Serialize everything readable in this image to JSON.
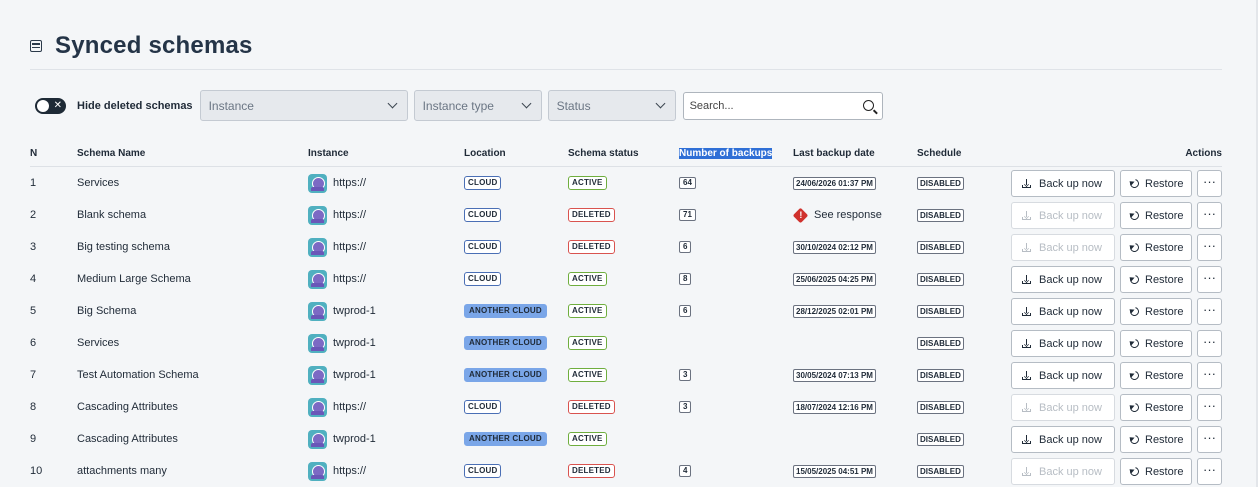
{
  "page": {
    "title": "Synced schemas",
    "icon": "list-icon"
  },
  "filters": {
    "toggle_label": "Hide deleted schemas",
    "toggle_on": true,
    "instance_placeholder": "Instance",
    "instance_type_placeholder": "Instance type",
    "status_placeholder": "Status",
    "search_placeholder": "Search..."
  },
  "columns": {
    "n": "N",
    "schema_name": "Schema Name",
    "instance": "Instance",
    "location": "Location",
    "schema_status": "Schema status",
    "backups": "Number of backups",
    "last_backup": "Last backup date",
    "schedule": "Schedule",
    "actions": "Actions"
  },
  "actions": {
    "backup_label": "Back up now",
    "restore_label": "Restore",
    "more_label": "···"
  },
  "rows": [
    {
      "n": "1",
      "name": "Services",
      "instance": "https://",
      "location": "CLOUD",
      "status": "ACTIVE",
      "backups": "64",
      "last_backup": "24/06/2026 01:37 PM",
      "schedule": "DISABLED",
      "backup_enabled": true
    },
    {
      "n": "2",
      "name": "Blank schema",
      "instance": "https://",
      "location": "CLOUD",
      "status": "DELETED",
      "backups": "71",
      "last_backup": "See response",
      "last_backup_error": true,
      "schedule": "DISABLED",
      "backup_enabled": false
    },
    {
      "n": "3",
      "name": "Big testing schema",
      "instance": "https://",
      "location": "CLOUD",
      "status": "DELETED",
      "backups": "6",
      "last_backup": "30/10/2024 02:12 PM",
      "schedule": "DISABLED",
      "backup_enabled": false
    },
    {
      "n": "4",
      "name": "Medium Large Schema",
      "instance": "https://",
      "location": "CLOUD",
      "status": "ACTIVE",
      "backups": "8",
      "last_backup": "25/06/2025 04:25 PM",
      "schedule": "DISABLED",
      "backup_enabled": true
    },
    {
      "n": "5",
      "name": "Big Schema",
      "instance": "twprod-1",
      "location": "ANOTHER CLOUD",
      "status": "ACTIVE",
      "backups": "6",
      "last_backup": "28/12/2025 02:01 PM",
      "schedule": "DISABLED",
      "backup_enabled": true
    },
    {
      "n": "6",
      "name": "Services",
      "instance": "twprod-1",
      "location": "ANOTHER CLOUD",
      "status": "ACTIVE",
      "backups": "",
      "last_backup": "",
      "schedule": "DISABLED",
      "backup_enabled": true
    },
    {
      "n": "7",
      "name": "Test Automation Schema",
      "instance": "twprod-1",
      "location": "ANOTHER CLOUD",
      "status": "ACTIVE",
      "backups": "3",
      "last_backup": "30/05/2024 07:13 PM",
      "schedule": "DISABLED",
      "backup_enabled": true
    },
    {
      "n": "8",
      "name": "Cascading Attributes",
      "instance": "https://",
      "location": "CLOUD",
      "status": "DELETED",
      "backups": "3",
      "last_backup": "18/07/2024 12:16 PM",
      "schedule": "DISABLED",
      "backup_enabled": false
    },
    {
      "n": "9",
      "name": "Cascading Attributes",
      "instance": "twprod-1",
      "location": "ANOTHER CLOUD",
      "status": "ACTIVE",
      "backups": "",
      "last_backup": "",
      "schedule": "DISABLED",
      "backup_enabled": true
    },
    {
      "n": "10",
      "name": "attachments many",
      "instance": "https://",
      "location": "CLOUD",
      "status": "DELETED",
      "backups": "4",
      "last_backup": "15/05/2025 04:51 PM",
      "schedule": "DISABLED",
      "backup_enabled": false
    }
  ]
}
